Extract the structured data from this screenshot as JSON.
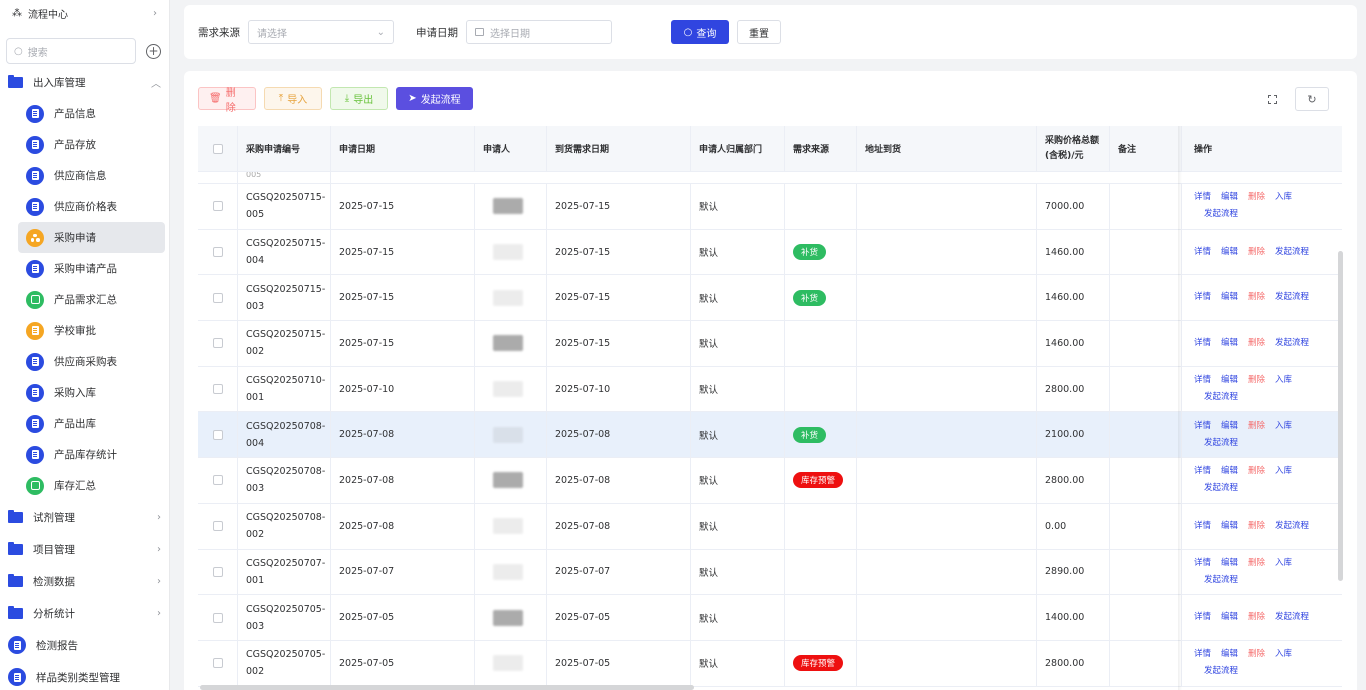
{
  "sidebar": {
    "top": {
      "label": "流程中心"
    },
    "search": {
      "placeholder": "搜索"
    },
    "group_inout": {
      "label": "出入库管理"
    },
    "items": [
      {
        "label": "产品信息",
        "icon": "doc-icon",
        "color": "blue"
      },
      {
        "label": "产品存放",
        "icon": "doc-icon",
        "color": "blue"
      },
      {
        "label": "供应商信息",
        "icon": "doc-icon",
        "color": "blue"
      },
      {
        "label": "供应商价格表",
        "icon": "doc-icon",
        "color": "blue"
      },
      {
        "label": "采购申请",
        "icon": "cluster-icon",
        "color": "orange"
      },
      {
        "label": "采购申请产品",
        "icon": "doc-icon",
        "color": "blue"
      },
      {
        "label": "产品需求汇总",
        "icon": "box-icon",
        "color": "green"
      },
      {
        "label": "学校审批",
        "icon": "doc-icon",
        "color": "orange"
      },
      {
        "label": "供应商采购表",
        "icon": "doc-icon",
        "color": "blue"
      },
      {
        "label": "采购入库",
        "icon": "doc-icon",
        "color": "blue"
      },
      {
        "label": "产品出库",
        "icon": "doc-icon",
        "color": "blue"
      },
      {
        "label": "产品库存统计",
        "icon": "doc-icon",
        "color": "blue"
      },
      {
        "label": "库存汇总",
        "icon": "box-icon",
        "color": "green"
      }
    ],
    "groups": [
      {
        "label": "试剂管理"
      },
      {
        "label": "项目管理"
      },
      {
        "label": "检测数据"
      },
      {
        "label": "分析统计"
      }
    ],
    "bottom": [
      {
        "label": "检测报告"
      },
      {
        "label": "样品类别类型管理"
      }
    ]
  },
  "filter": {
    "source_label": "需求来源",
    "source_placeholder": "请选择",
    "date_label": "申请日期",
    "date_placeholder": "选择日期",
    "query_label": "查询",
    "reset_label": "重置"
  },
  "toolbar": {
    "delete_label": "删除",
    "import_label": "导入",
    "export_label": "导出",
    "flow_label": "发起流程"
  },
  "table": {
    "headers": {
      "code": "采购申请编号",
      "date": "申请日期",
      "applicant": "申请人",
      "arrival": "到货需求日期",
      "dept": "申请人归属部门",
      "source": "需求来源",
      "address": "地址到货",
      "price_line1": "采购价格总额",
      "price_line2": "(含税)/元",
      "remark": "备注",
      "ops": "操作"
    },
    "partial_row": "005",
    "ops_labels": {
      "detail": "详情",
      "edit": "编辑",
      "delete": "删除",
      "instock": "入库",
      "flow": "发起流程"
    },
    "rows": [
      {
        "code_a": "CGSQ20250715-",
        "code_b": "005",
        "date": "2025-07-15",
        "arrival": "2025-07-15",
        "dept": "默认",
        "tag": "",
        "tag_color": "",
        "price": "7000.00",
        "ops_type": "instock"
      },
      {
        "code_a": "CGSQ20250715-",
        "code_b": "004",
        "date": "2025-07-15",
        "arrival": "2025-07-15",
        "dept": "默认",
        "tag": "补货",
        "tag_color": "g",
        "price": "1460.00",
        "ops_type": "flow"
      },
      {
        "code_a": "CGSQ20250715-",
        "code_b": "003",
        "date": "2025-07-15",
        "arrival": "2025-07-15",
        "dept": "默认",
        "tag": "补货",
        "tag_color": "g",
        "price": "1460.00",
        "ops_type": "flow"
      },
      {
        "code_a": "CGSQ20250715-",
        "code_b": "002",
        "date": "2025-07-15",
        "arrival": "2025-07-15",
        "dept": "默认",
        "tag": "",
        "tag_color": "",
        "price": "1460.00",
        "ops_type": "flow"
      },
      {
        "code_a": "CGSQ20250710-",
        "code_b": "001",
        "date": "2025-07-10",
        "arrival": "2025-07-10",
        "dept": "默认",
        "tag": "",
        "tag_color": "",
        "price": "2800.00",
        "ops_type": "instock"
      },
      {
        "code_a": "CGSQ20250708-",
        "code_b": "004",
        "date": "2025-07-08",
        "arrival": "2025-07-08",
        "dept": "默认",
        "tag": "补货",
        "tag_color": "g",
        "price": "2100.00",
        "ops_type": "instock",
        "highlight": true
      },
      {
        "code_a": "CGSQ20250708-",
        "code_b": "003",
        "date": "2025-07-08",
        "arrival": "2025-07-08",
        "dept": "默认",
        "tag": "库存预警",
        "tag_color": "r",
        "price": "2800.00",
        "ops_type": "instock"
      },
      {
        "code_a": "CGSQ20250708-",
        "code_b": "002",
        "date": "2025-07-08",
        "arrival": "2025-07-08",
        "dept": "默认",
        "tag": "",
        "tag_color": "",
        "price": "0.00",
        "ops_type": "flow"
      },
      {
        "code_a": "CGSQ20250707-",
        "code_b": "001",
        "date": "2025-07-07",
        "arrival": "2025-07-07",
        "dept": "默认",
        "tag": "",
        "tag_color": "",
        "price": "2890.00",
        "ops_type": "instock"
      },
      {
        "code_a": "CGSQ20250705-",
        "code_b": "003",
        "date": "2025-07-05",
        "arrival": "2025-07-05",
        "dept": "默认",
        "tag": "",
        "tag_color": "",
        "price": "1400.00",
        "ops_type": "flow"
      },
      {
        "code_a": "CGSQ20250705-",
        "code_b": "002",
        "date": "2025-07-05",
        "arrival": "2025-07-05",
        "dept": "默认",
        "tag": "库存预警",
        "tag_color": "r",
        "price": "2800.00",
        "ops_type": "instock"
      }
    ]
  }
}
